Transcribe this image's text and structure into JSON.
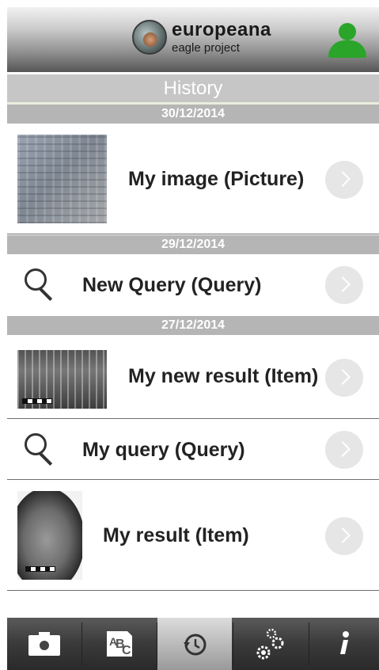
{
  "header": {
    "logo_title": "europeana",
    "logo_subtitle": "eagle project",
    "user_icon": "user-icon",
    "colors": {
      "user": "#2aa52a"
    }
  },
  "history": {
    "title": "History"
  },
  "groups": [
    {
      "date": "30/12/2014"
    },
    {
      "date": "29/12/2014"
    },
    {
      "date": "27/12/2014"
    }
  ],
  "items": [
    {
      "label": "My image (Picture)",
      "kind": "picture",
      "icon": "chevron-right-icon"
    },
    {
      "label": "New Query (Query)",
      "kind": "query",
      "icon": "search-icon"
    },
    {
      "label": "My new result (Item)",
      "kind": "item",
      "icon": "chevron-right-icon"
    },
    {
      "label": "My query (Query)",
      "kind": "query",
      "icon": "search-icon"
    },
    {
      "label": "My result (Item)",
      "kind": "item",
      "icon": "chevron-right-icon"
    }
  ],
  "tabs": [
    {
      "name": "camera",
      "icon": "camera-icon"
    },
    {
      "name": "text-recognition",
      "icon": "abc-icon"
    },
    {
      "name": "history",
      "icon": "clock-history-icon",
      "active": true
    },
    {
      "name": "settings",
      "icon": "gears-icon"
    },
    {
      "name": "info",
      "icon": "info-icon"
    }
  ]
}
